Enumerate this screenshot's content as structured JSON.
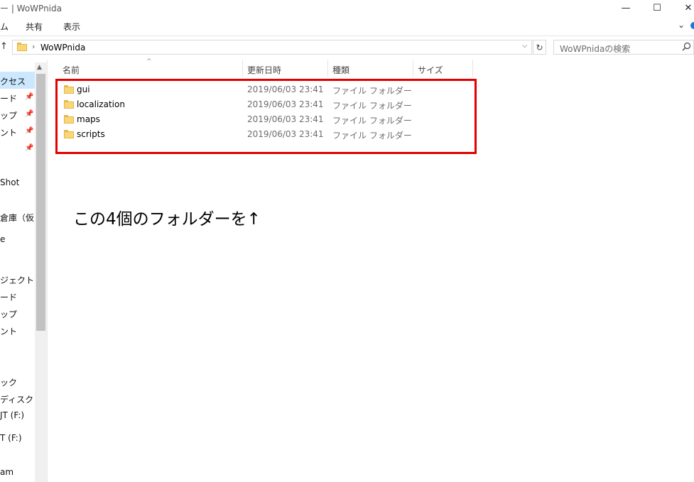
{
  "window": {
    "title": "ー | WoWPnida",
    "controls": {
      "minimize": "—",
      "maximize": "☐",
      "close": "✕"
    }
  },
  "ribbon": {
    "tabs": [
      "ム",
      "共有",
      "表示"
    ],
    "expand_glyph": "⌄"
  },
  "address": {
    "up_glyph": "↑",
    "separator": "›",
    "path": "WoWPnida",
    "dropdown_glyph": "⌵",
    "refresh_glyph": "↻"
  },
  "search": {
    "placeholder": "WoWPnidaの検索",
    "icon": "search-icon"
  },
  "nav": {
    "items": [
      {
        "label": "クセス"
      },
      {
        "label": "ード",
        "pinned": true
      },
      {
        "label": "ップ",
        "pinned": true
      },
      {
        "label": "ント",
        "pinned": true
      },
      {
        "label": "",
        "pinned": true
      },
      {
        "label": "Shot"
      },
      {
        "label": "倉庫（仮"
      },
      {
        "label": "e"
      },
      {
        "label": "ジェクト"
      },
      {
        "label": "ード"
      },
      {
        "label": "ップ"
      },
      {
        "label": "ント"
      },
      {
        "label": "ック"
      },
      {
        "label": "ディスク (C"
      },
      {
        "label": "JT (F:)"
      },
      {
        "label": "T (F:)"
      },
      {
        "label": "am"
      }
    ],
    "pin_glyph": "📌"
  },
  "columns": {
    "name": "名前",
    "modified": "更新日時",
    "type": "種類",
    "size": "サイズ",
    "sort_glyph": "^"
  },
  "files": [
    {
      "name": "gui",
      "modified": "2019/06/03 23:41",
      "type": "ファイル フォルダー"
    },
    {
      "name": "localization",
      "modified": "2019/06/03 23:41",
      "type": "ファイル フォルダー"
    },
    {
      "name": "maps",
      "modified": "2019/06/03 23:41",
      "type": "ファイル フォルダー"
    },
    {
      "name": "scripts",
      "modified": "2019/06/03 23:41",
      "type": "ファイル フォルダー"
    }
  ],
  "annotation": {
    "text": "この4個のフォルダーを↑"
  },
  "colors": {
    "highlight": "#e20000",
    "selection": "#cce8ff",
    "folder": "#f8d775"
  }
}
